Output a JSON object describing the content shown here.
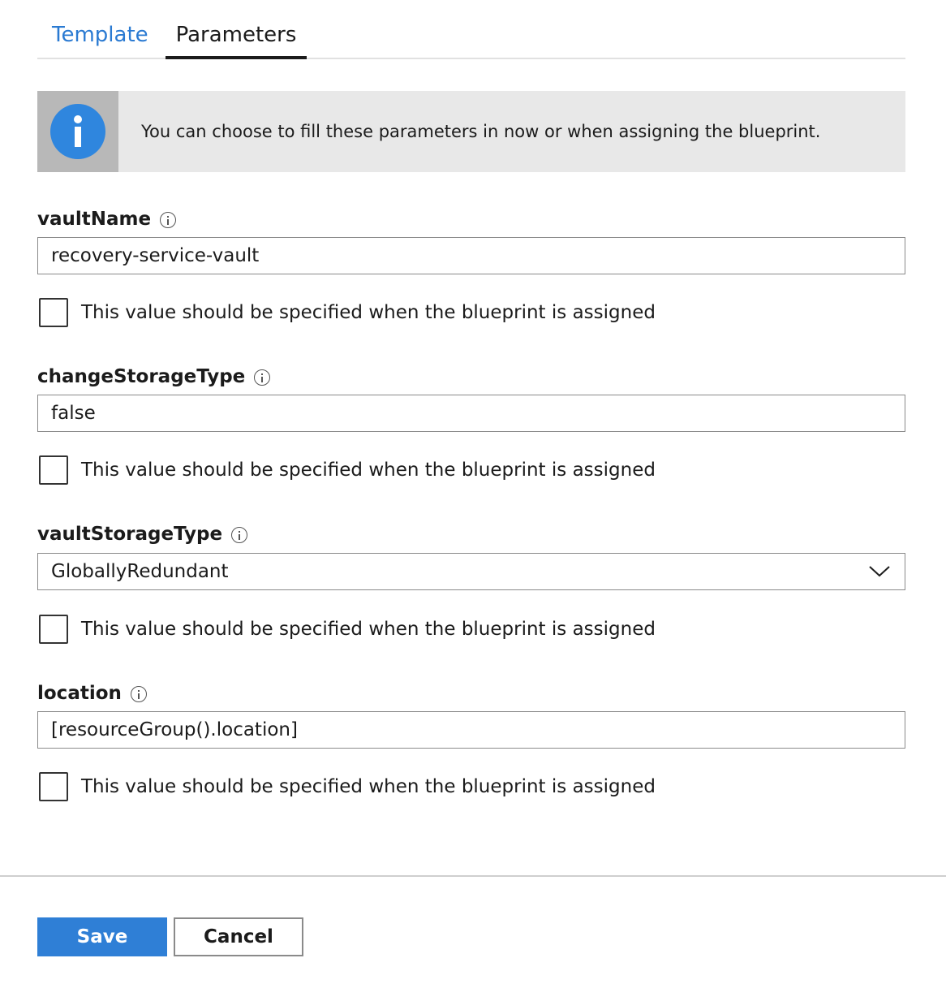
{
  "tabs": [
    {
      "label": "Template",
      "active": false
    },
    {
      "label": "Parameters",
      "active": true
    }
  ],
  "info_banner": {
    "icon": "info-icon",
    "text": "You can choose to fill these parameters in now or when assigning the blueprint."
  },
  "fields": [
    {
      "label": "vaultName",
      "type": "text",
      "value": "recovery-service-vault",
      "assign_later_label": "This value should be specified when the blueprint is assigned",
      "assign_later_checked": false
    },
    {
      "label": "changeStorageType",
      "type": "text",
      "value": "false",
      "assign_later_label": "This value should be specified when the blueprint is assigned",
      "assign_later_checked": false
    },
    {
      "label": "vaultStorageType",
      "type": "select",
      "value": "GloballyRedundant",
      "assign_later_label": "This value should be specified when the blueprint is assigned",
      "assign_later_checked": false
    },
    {
      "label": "location",
      "type": "text",
      "value": "[resourceGroup().location]",
      "assign_later_label": "This value should be specified when the blueprint is assigned",
      "assign_later_checked": false
    }
  ],
  "footer": {
    "save_label": "Save",
    "cancel_label": "Cancel"
  },
  "colors": {
    "accent": "#2f7fd6",
    "tab_link": "#2a7ad2",
    "banner_bg": "#e8e8e8",
    "info_icon": "#2f86de"
  }
}
